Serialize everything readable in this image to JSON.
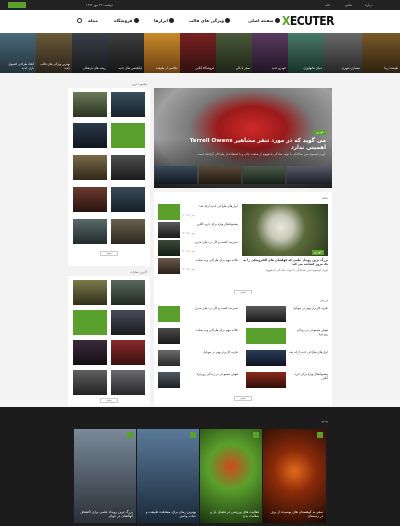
{
  "topbar": {
    "links": [
      "خانه",
      "تماس",
      "درباره"
    ],
    "date": "دوشنبه، ۲۳ مهر ۱۳۹۶"
  },
  "header": {
    "logo_x": "X",
    "logo_rest": "ECUTER",
    "nav": [
      "صفحه اصلی",
      "ویژگی های قالب",
      "ابزارها",
      "فروشگاه",
      "مجله"
    ]
  },
  "strip": [
    {
      "caption": "اتحاد طراحی کنسول بازی جدید"
    },
    {
      "caption": "بهترین ویژگی های قالب جدید"
    },
    {
      "caption": "ریشه های فرهنگی"
    },
    {
      "caption": "اپلیکیشن های جدید"
    },
    {
      "caption": "عکاسی از طبیعت"
    },
    {
      "caption": "فروشگاه آنلاین"
    },
    {
      "caption": "سفر با بالن"
    },
    {
      "caption": "خودرو جدید"
    },
    {
      "caption": "دنیای تکنولوژی"
    },
    {
      "caption": "معماری شهری"
    },
    {
      "caption": "طبیعت زیبا"
    }
  ],
  "hero": {
    "label": "خودرو",
    "title": "Terrell Owens می گوید که در مورد تنفر مشاهیر اهمیتی ندارد",
    "excerpt": "لورم ایپسوم متن ساختگی با تولید سادگی نامفهوم از صنعت چاپ و با استفاده از طراحان گرافیک است."
  },
  "section1": {
    "title": "مجله",
    "button": "بیشتر"
  },
  "section2": {
    "title": "ورزش",
    "button": "بیشتر"
  },
  "sidebar": {
    "title": "محبوب ترین",
    "button": "بیشتر"
  },
  "sidebar2": {
    "title": "آخرین نظرات",
    "button": "بیشتر"
  },
  "feature": {
    "title": "بزرگ ترین رویداد علمی که کهکشان های الکترونیکی را به یک مرور کشانده می کند",
    "excerpt": "لورم ایپسوم متن ساختگی با تولید سادگی نامفهوم"
  },
  "items": [
    "ابزارهای طراحی جدید ارائه شد",
    "پیشنهادهای ویژه برای خرید آنلاین",
    "مدیریت کسب و کار در دنیای مدرن",
    "نکات مهم برای طراحی وب سایت",
    "تجربه کاربری بهتر در موبایل",
    "هوش مصنوعی در زندگی روزمره"
  ],
  "meta": "۲۳ مهر ۱۳۹۶",
  "footer": {
    "title": "ویدیو",
    "cards": [
      {
        "caption": "بزرگ ترین رویداد علمی برای اکتشاف کهکشان در جهان"
      },
      {
        "caption": "بهترین زمان برای مشاهده طبیعت و حیات وحش"
      },
      {
        "caption": "فعالیت های ورزشی در فضای باز و سلامت بدن"
      },
      {
        "caption": "سفر به کوهستان های پوشیده از برف در زمستان"
      }
    ]
  }
}
